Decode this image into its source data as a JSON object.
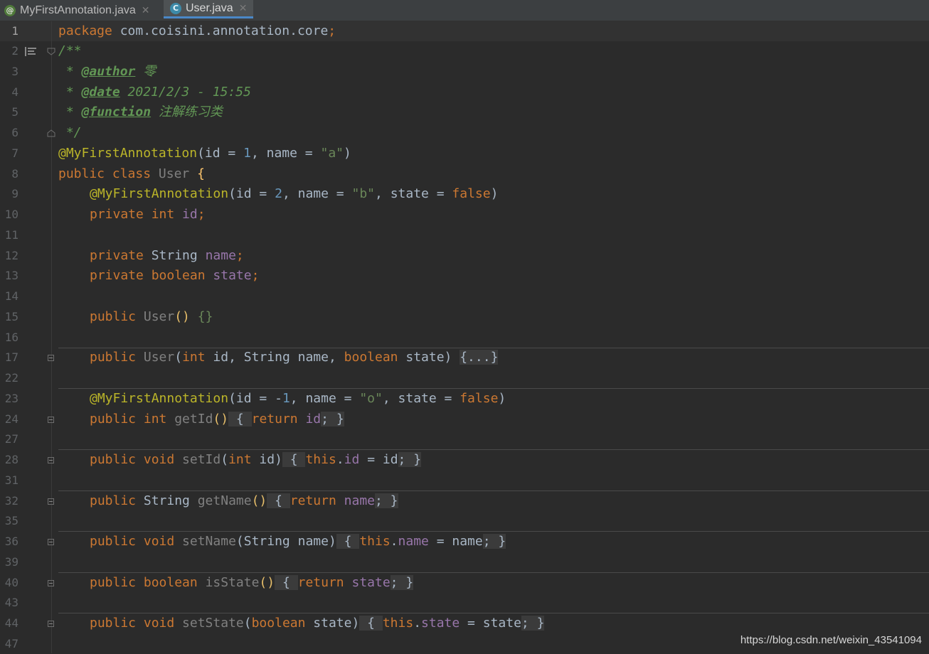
{
  "tabs": [
    {
      "label": "MyFirstAnnotation.java",
      "icon": "annotation-file-icon",
      "active": false
    },
    {
      "label": "User.java",
      "icon": "class-file-icon",
      "active": true
    }
  ],
  "line_numbers": [
    "1",
    "2",
    "3",
    "4",
    "5",
    "6",
    "7",
    "8",
    "9",
    "10",
    "11",
    "12",
    "13",
    "14",
    "15",
    "16",
    "17",
    "22",
    "23",
    "24",
    "27",
    "28",
    "31",
    "32",
    "35",
    "36",
    "39",
    "40",
    "43",
    "44",
    "47"
  ],
  "code": {
    "l1_pkg": "package",
    "l1_rest": " com.coisini.annotation.core",
    "l1_semi": ";",
    "l2": "/**",
    "l3_star": " * ",
    "l3_tag": "@author",
    "l3_val": " 零",
    "l4_star": " * ",
    "l4_tag": "@date",
    "l4_val": " 2021/2/3 - 15:55",
    "l5_star": " * ",
    "l5_tag": "@function",
    "l5_val": " 注解练习类",
    "l6": " */",
    "l7_ann": "@MyFirstAnnotation",
    "l7_a": "(id = ",
    "l7_n": "1",
    "l7_b": ", name = ",
    "l7_s": "\"a\"",
    "l7_c": ")",
    "l8_kw": "public class ",
    "l8_cls": "User",
    "l8_br": " {",
    "l9_ann": "@MyFirstAnnotation",
    "l9_a": "(id = ",
    "l9_n": "2",
    "l9_b": ", name = ",
    "l9_s": "\"b\"",
    "l9_c": ", state = ",
    "l9_f": "false",
    "l9_d": ")",
    "l10_kw": "private int ",
    "l10_fld": "id",
    "l10_semi": ";",
    "l12_kw": "private ",
    "l12_type": "String ",
    "l12_fld": "name",
    "l12_semi": ";",
    "l13_kw": "private boolean ",
    "l13_fld": "state",
    "l13_semi": ";",
    "l15_kw": "public ",
    "l15_cls": "User",
    "l15_p": "() ",
    "l15_b": "{}",
    "l17_kw": "public ",
    "l17_cls": "User",
    "l17_a": "(",
    "l17_t1": "int",
    "l17_b": " id, ",
    "l17_t2": "String",
    "l17_c": " name, ",
    "l17_t3": "boolean",
    "l17_d": " state) ",
    "l17_fold": "{...}",
    "l23_ann": "@MyFirstAnnotation",
    "l23_a": "(id = -",
    "l23_n": "1",
    "l23_b": ", name = ",
    "l23_s": "\"o\"",
    "l23_c": ", state = ",
    "l23_f": "false",
    "l23_d": ")",
    "l24_kw": "public int ",
    "l24_m": "getId",
    "l24_p": "()",
    "l24_o": " { ",
    "l24_r": "return ",
    "l24_fld": "id",
    "l24_e": "; }",
    "l28_kw": "public void ",
    "l28_m": "setId",
    "l28_a": "(",
    "l28_t": "int",
    "l28_b": " id)",
    "l28_o": " { ",
    "l28_this": "this",
    "l28_dot": ".",
    "l28_fld": "id",
    "l28_e": " = id",
    "l28_c": "; }",
    "l32_kw": "public ",
    "l32_t": "String ",
    "l32_m": "getName",
    "l32_p": "()",
    "l32_o": " { ",
    "l32_r": "return ",
    "l32_fld": "name",
    "l32_e": "; }",
    "l36_kw": "public void ",
    "l36_m": "setName",
    "l36_a": "(String name)",
    "l36_o": " { ",
    "l36_this": "this",
    "l36_dot": ".",
    "l36_fld": "name",
    "l36_e": " = name",
    "l36_c": "; }",
    "l40_kw": "public boolean ",
    "l40_m": "isState",
    "l40_p": "()",
    "l40_o": " { ",
    "l40_r": "return ",
    "l40_fld": "state",
    "l40_e": "; }",
    "l44_kw": "public void ",
    "l44_m": "setState",
    "l44_a": "(",
    "l44_t": "boolean",
    "l44_b": " state)",
    "l44_o": " { ",
    "l44_this": "this",
    "l44_dot": ".",
    "l44_fld": "state",
    "l44_e": " = state",
    "l44_c": "; }"
  },
  "watermark": "https://blog.csdn.net/weixin_43541094",
  "colors": {
    "background": "#2b2b2b",
    "keyword": "#cc7832",
    "annotation": "#bbb529",
    "number": "#6897bb",
    "string": "#6a8759",
    "field": "#9876aa",
    "tab_accent": "#4a88c7"
  }
}
